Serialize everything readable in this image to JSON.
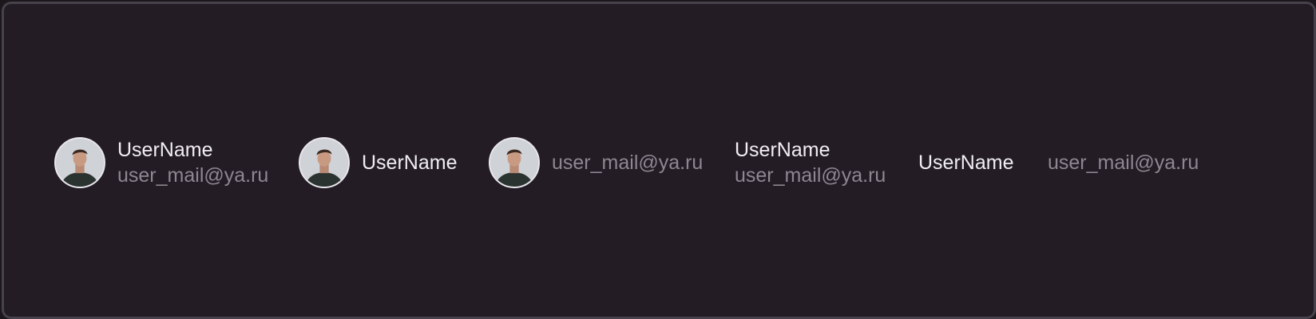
{
  "users": [
    {
      "variant": "avatar-name-email",
      "name": "UserName",
      "email": "user_mail@ya.ru"
    },
    {
      "variant": "avatar-name",
      "name": "UserName"
    },
    {
      "variant": "avatar-email",
      "email": "user_mail@ya.ru"
    },
    {
      "variant": "name-email",
      "name": "UserName",
      "email": "user_mail@ya.ru"
    },
    {
      "variant": "name",
      "name": "UserName"
    },
    {
      "variant": "email",
      "email": "user_mail@ya.ru"
    }
  ],
  "colors": {
    "background": "#231c25",
    "border": "#46414a",
    "name_text": "#f1eef3",
    "email_text": "#8d8792"
  }
}
